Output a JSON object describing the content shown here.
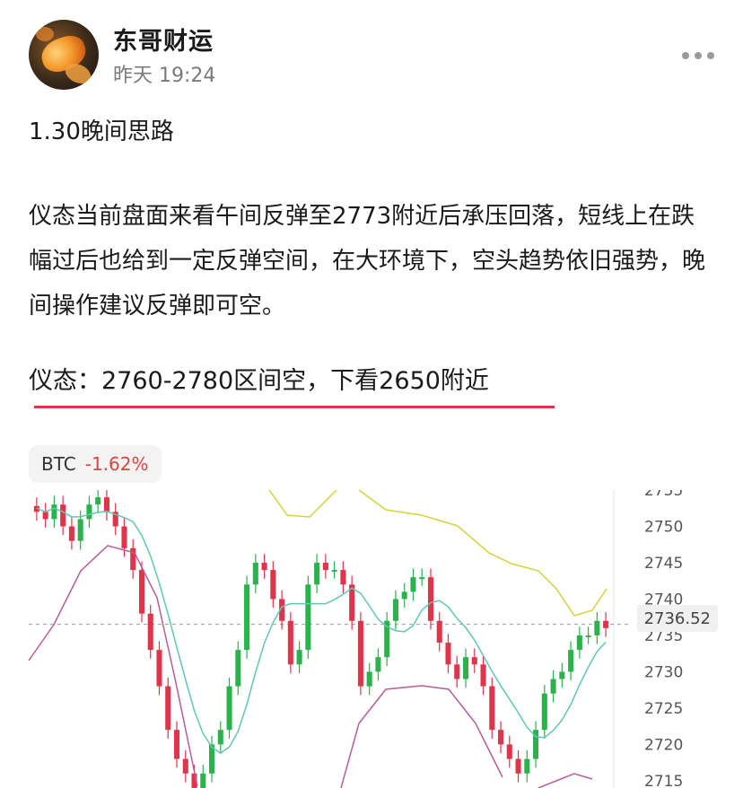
{
  "post": {
    "author": "东哥财运",
    "time": "昨天 19:24",
    "title": "1.30晚间思路",
    "paragraph": "仪态当前盘面来看午间反弹至2773附近后承压回落，短线上在跌幅过后也给到一定反弹空间，在大环境下，空头趋势依旧强势，晚间操作建议反弹即可空。",
    "key_line": "仪态：2760-2780区间空，下看2650附近"
  },
  "ticker": {
    "symbol": "BTC",
    "change": "-1.62%"
  },
  "colors": {
    "up": "#2bb24c",
    "down": "#e0344a",
    "accent": "#e0344a"
  },
  "chart_data": {
    "type": "candlestick",
    "current_price": "2736.52",
    "y_ticks": [
      "2755",
      "2750",
      "2745",
      "2740",
      "2735",
      "2730",
      "2725",
      "2720",
      "2715"
    ],
    "ylim": [
      2714,
      2755
    ]
  }
}
